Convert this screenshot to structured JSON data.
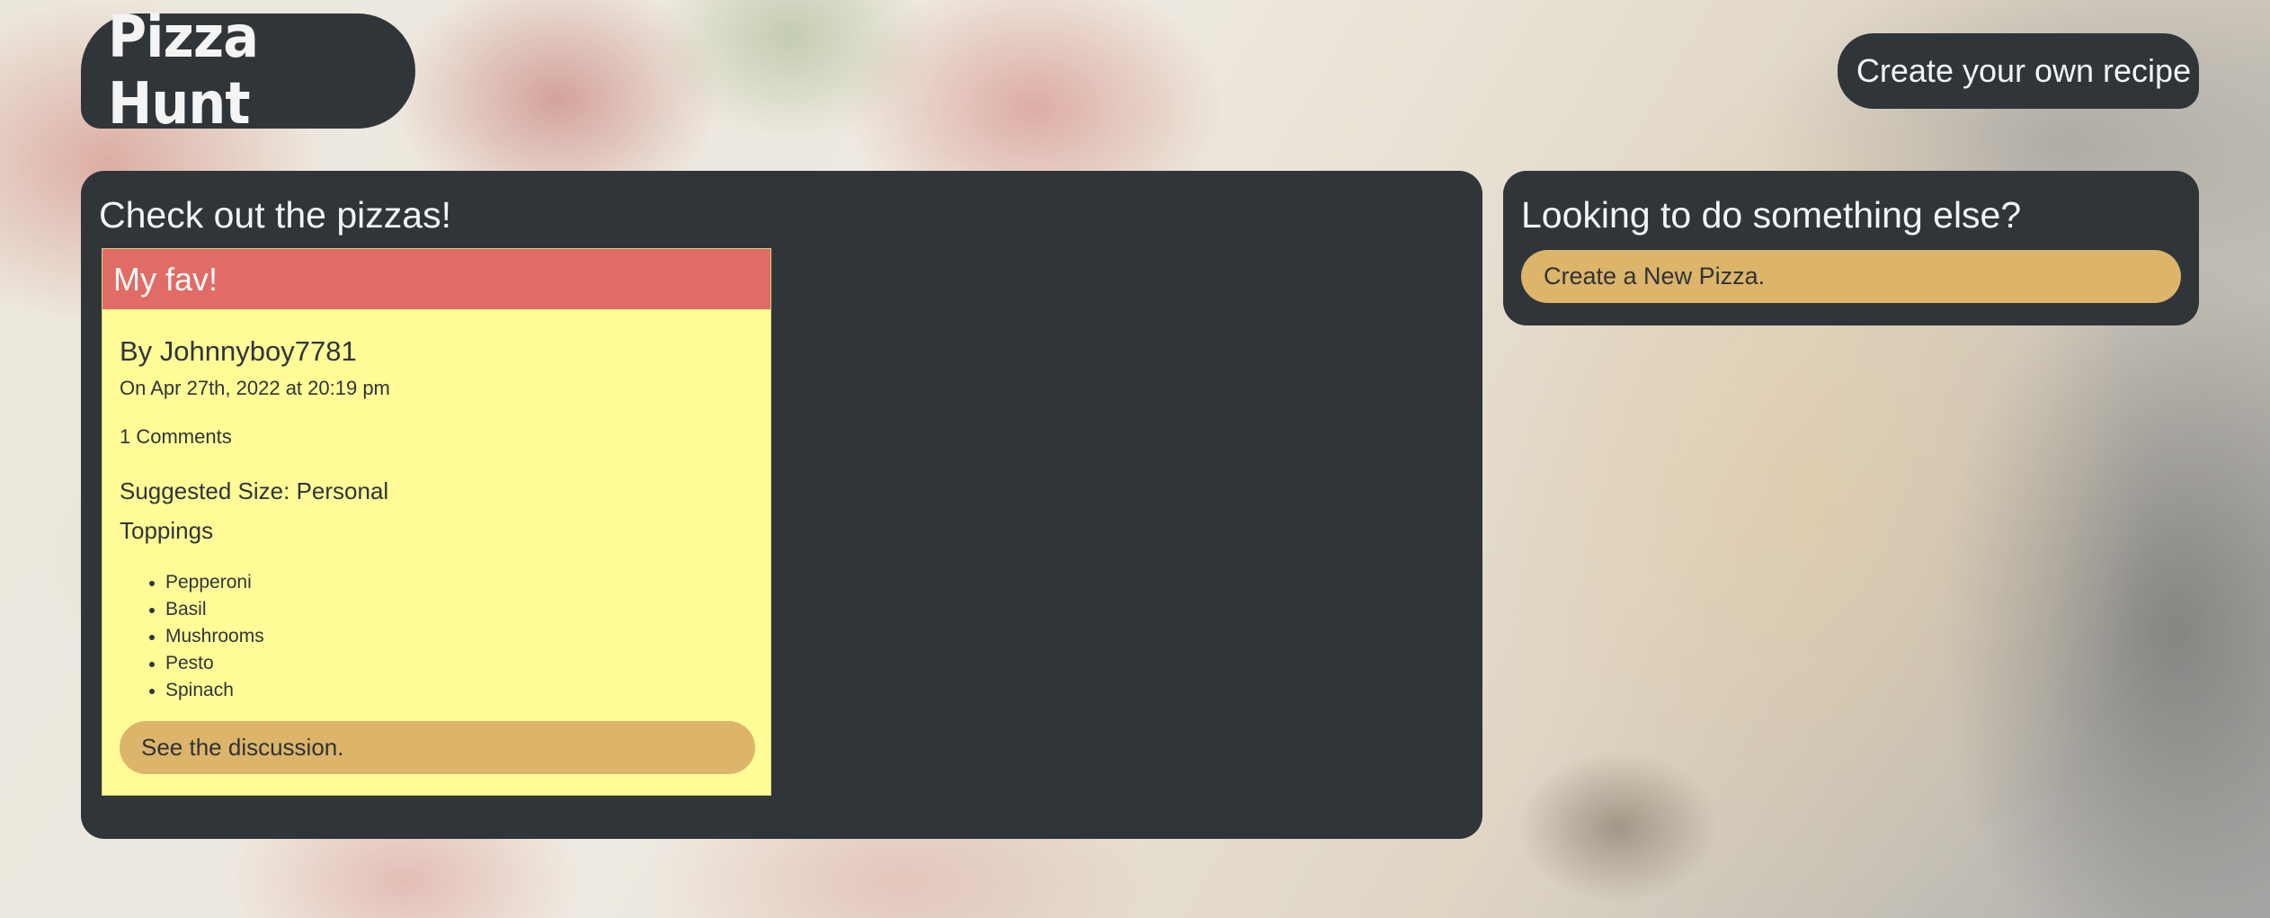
{
  "app": {
    "logo_text": "Pizza Hunt",
    "create_recipe_label": "Create your own recipe"
  },
  "main": {
    "title": "Check out the pizzas!",
    "pizzas": [
      {
        "name": "My fav!",
        "author": "By Johnnyboy7781",
        "date": "On Apr 27th, 2022 at 20:19 pm",
        "comments": "1 Comments",
        "size": "Suggested Size: Personal",
        "toppings_title": "Toppings",
        "toppings": [
          "Pepperoni",
          "Basil",
          "Mushrooms",
          "Pesto",
          "Spinach"
        ],
        "discussion_label": "See the discussion."
      }
    ]
  },
  "sidebar": {
    "title": "Looking to do something else?",
    "new_pizza_label": "Create a New Pizza."
  },
  "colors": {
    "panel": "#30353a",
    "card_bg": "#fffb97",
    "card_header": "#e06c65",
    "button": "#dcb46a"
  }
}
